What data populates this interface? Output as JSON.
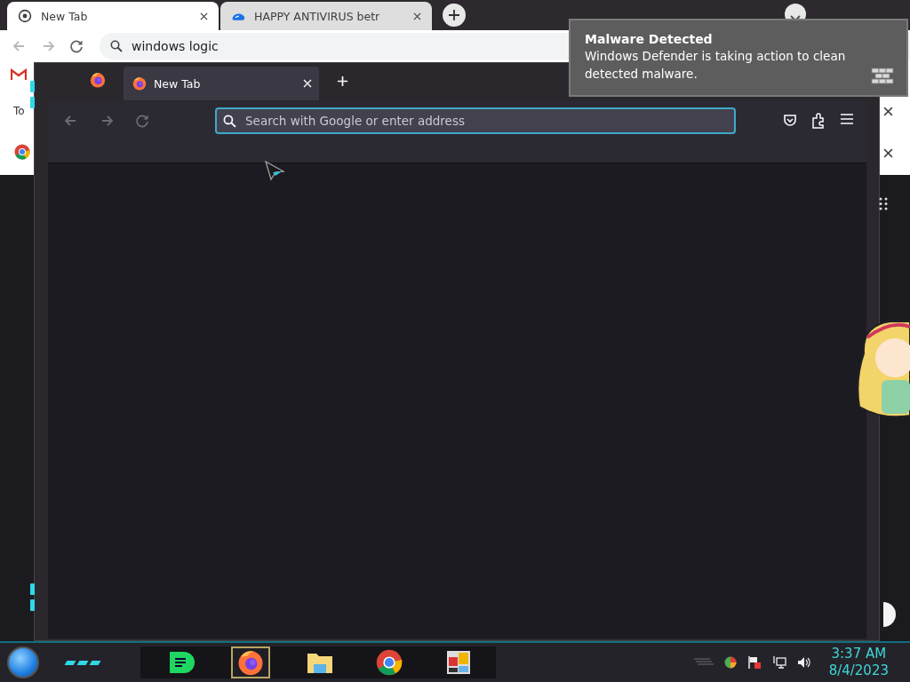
{
  "chrome_window": {
    "tabs": [
      {
        "title": "New Tab",
        "kind": "chrome",
        "selected": true
      },
      {
        "title": "HAPPY ANTIVIRUS betr",
        "kind": "cloud",
        "selected": false
      }
    ],
    "nav": [
      {
        "kind": "back",
        "disabled": true
      },
      {
        "kind": "forward",
        "disabled": true
      },
      {
        "kind": "reload",
        "disabled": false
      }
    ],
    "address": "windows logic",
    "side_text": "To"
  },
  "firefox_window": {
    "tabs": [
      {
        "title": "New Tab",
        "selected": true
      }
    ],
    "nav": [
      {
        "kind": "back",
        "disabled": true
      },
      {
        "kind": "forward",
        "disabled": true
      },
      {
        "kind": "reload",
        "disabled": true
      }
    ],
    "address_placeholder": "Search with Google or enter address"
  },
  "notification": {
    "title": "Malware Detected",
    "message": "Windows Defender is taking action to clean detected malware."
  },
  "taskbar": {
    "apps": [
      {
        "kind": "notes",
        "selected": false
      },
      {
        "kind": "firefox",
        "selected": true
      },
      {
        "kind": "folder",
        "selected": false
      },
      {
        "kind": "chrome",
        "selected": false
      },
      {
        "kind": "tiles",
        "selected": false
      }
    ],
    "time": "3:37 AM",
    "date": "8/4/2023"
  }
}
